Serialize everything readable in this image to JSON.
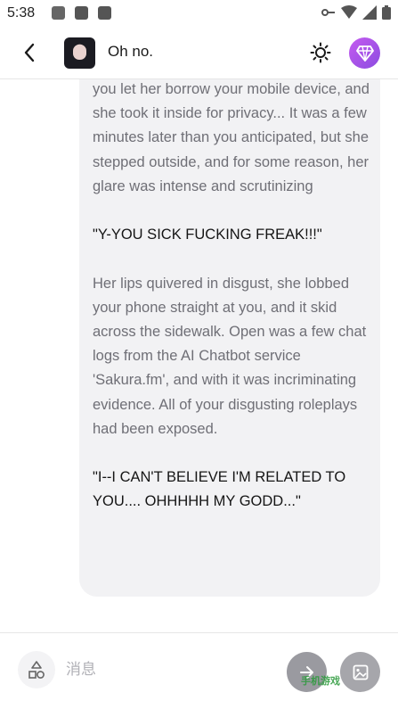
{
  "status_bar": {
    "time": "5:38"
  },
  "header": {
    "title": "Oh no."
  },
  "message": {
    "paragraphs": [
      {
        "kind": "narration",
        "text": "you let her borrow your mobile device, and she took it inside for privacy... It was a few minutes later than you anticipated, but she stepped outside, and for some reason, her glare was intense and scrutinizing"
      },
      {
        "kind": "speech",
        "text": "\"Y-YOU SICK FUCKING FREAK!!!\""
      },
      {
        "kind": "narration",
        "text": "Her lips quivered in disgust, she lobbed your phone straight at you, and it skid across the sidewalk. Open was a few chat logs from the AI Chatbot service 'Sakura.fm', and with it was incriminating evidence. All of your disgusting roleplays had been exposed."
      },
      {
        "kind": "speech",
        "text": "\"I--I CAN'T BELIEVE I'M RELATED TO YOU.... OHHHHH MY GODD...\""
      }
    ]
  },
  "composer": {
    "placeholder": "消息"
  },
  "watermark": {
    "text": "手机游戏"
  },
  "colors": {
    "gem_gradient": [
      "#c55cf0",
      "#8b4be0"
    ],
    "bubble": "#f2f2f4"
  },
  "icons": {
    "back": "chevron-left-icon",
    "theme": "sun-icon",
    "premium": "gem-icon",
    "shapes": "shapes-icon",
    "send": "arrow-right-icon",
    "image": "image-icon"
  }
}
